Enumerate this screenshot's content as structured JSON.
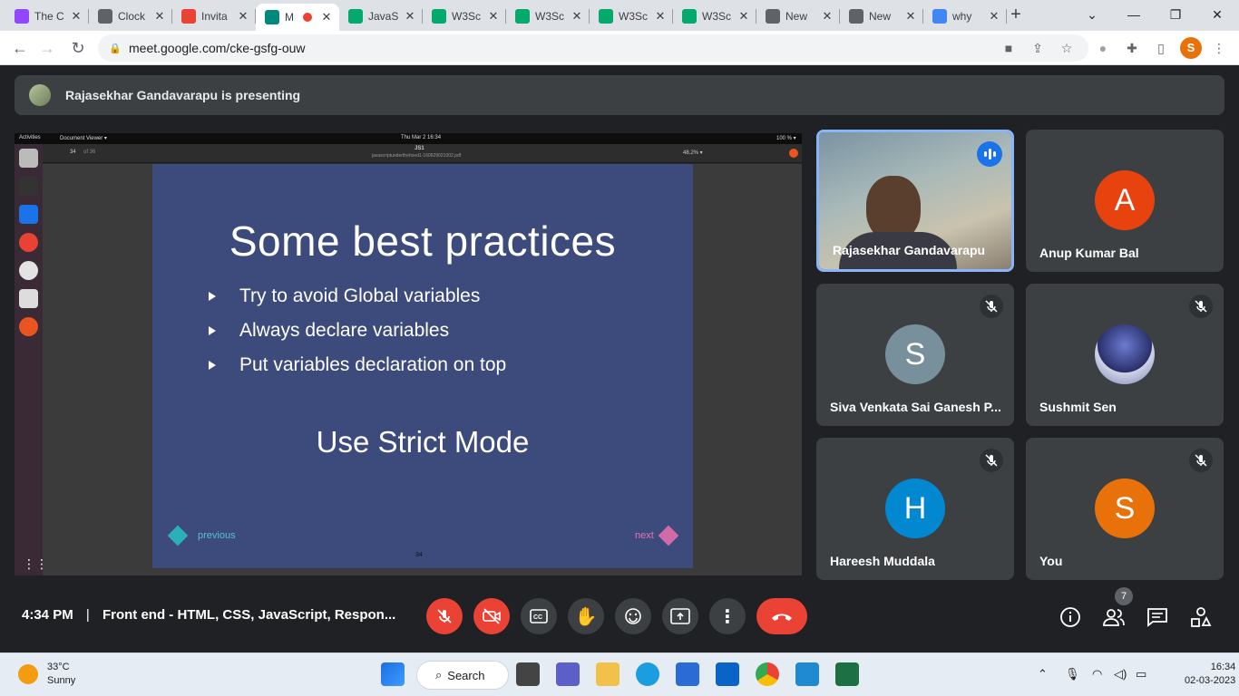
{
  "browser": {
    "tabs": [
      {
        "title": "The C",
        "favicon": "twitch-icon",
        "color": "#9146ff"
      },
      {
        "title": "Clock",
        "favicon": "clock-icon",
        "color": "#5f6368"
      },
      {
        "title": "Invita",
        "favicon": "gmail-icon",
        "color": "#ea4335"
      },
      {
        "title": "M",
        "favicon": "meet-icon",
        "color": "#00897b"
      },
      {
        "title": "JavaS",
        "favicon": "w3schools-icon",
        "color": "#04aa6d"
      },
      {
        "title": "W3Sc",
        "favicon": "w3schools-icon",
        "color": "#04aa6d"
      },
      {
        "title": "W3Sc",
        "favicon": "w3schools-icon",
        "color": "#04aa6d"
      },
      {
        "title": "W3Sc",
        "favicon": "w3schools-icon",
        "color": "#04aa6d"
      },
      {
        "title": "W3Sc",
        "favicon": "w3schools-icon",
        "color": "#04aa6d"
      },
      {
        "title": "New",
        "favicon": "chrome-icon",
        "color": "#5f6368"
      },
      {
        "title": "New",
        "favicon": "chrome-icon",
        "color": "#5f6368"
      },
      {
        "title": "why",
        "favicon": "google-icon",
        "color": "#4285f4"
      }
    ],
    "url": "meet.google.com/cke-gsfg-ouw",
    "profile_initial": "S"
  },
  "meet": {
    "presenting_text": "Rajasekhar Gandavarapu is presenting",
    "time": "4:34 PM",
    "separator": "|",
    "meeting_title": "Front end - HTML, CSS, JavaScript, Respon...",
    "participant_count": "7",
    "participants": [
      {
        "name": "Rajasekhar Gandavarapu",
        "type": "video",
        "speaking": true
      },
      {
        "name": "Anup Kumar Bal",
        "initial": "A",
        "color": "#e8430f",
        "muted": false
      },
      {
        "name": "Siva Venkata Sai Ganesh P...",
        "initial": "S",
        "color": "#78909c",
        "muted": true
      },
      {
        "name": "Sushmit Sen",
        "type": "image-avatar",
        "muted": true
      },
      {
        "name": "Hareesh Muddala",
        "initial": "H",
        "color": "#0288d1",
        "muted": true
      },
      {
        "name": "You",
        "initial": "S",
        "color": "#e8710a",
        "muted": true
      }
    ]
  },
  "shared_screen": {
    "topbar": {
      "activities": "Activities",
      "app": "Document Viewer ▾",
      "clock": "Thu Mar 2  16:34",
      "battery": "100 % ▾"
    },
    "viewer": {
      "page": "34",
      "of": "of 36",
      "doc_title": "JS1",
      "file_name": "javascriptunderthehood1-160629021002.pdf",
      "zoom": "48.2% ▾"
    },
    "slide": {
      "title": "Some best practices",
      "bullets": [
        "Try to avoid Global variables",
        "Always declare variables",
        "Put variables declaration on top"
      ],
      "emphasis": "Use Strict Mode",
      "previous": "previous",
      "next": "next",
      "prev_arrow": "<",
      "next_arrow": ">",
      "page_number": "34"
    }
  },
  "taskbar": {
    "temperature": "33°C",
    "condition": "Sunny",
    "search_label": "Search",
    "time": "16:34",
    "date": "02-03-2023"
  }
}
